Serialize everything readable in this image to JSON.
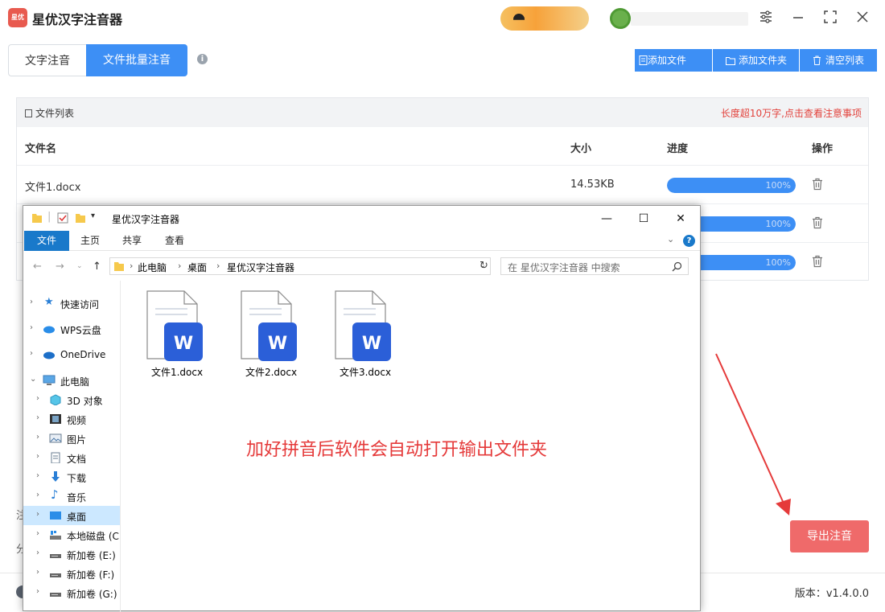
{
  "app": {
    "title": "星优汉字注音器",
    "logo_text": "星优",
    "version": "版本：v1.4.0.0"
  },
  "tabs": [
    {
      "label": "文字注音",
      "active": false
    },
    {
      "label": "文件批量注音",
      "active": true
    }
  ],
  "actions": {
    "add_file": "添加文件",
    "add_folder": "添加文件夹",
    "clear_list": "清空列表"
  },
  "file_list": {
    "title": "文件列表",
    "note": "长度超10万字,点击查看注意事项",
    "columns": [
      "文件名",
      "大小",
      "进度",
      "操作"
    ],
    "rows": [
      {
        "name": "文件1.docx",
        "size": "14.53KB",
        "progress": 100,
        "progress_label": "100%"
      },
      {
        "name": "",
        "size": "",
        "progress": 100,
        "progress_label": "100%"
      },
      {
        "name": "",
        "size": "",
        "progress": 100,
        "progress_label": "100%"
      }
    ]
  },
  "bottom": {
    "export_label": "导出注音",
    "stub_1": "注",
    "stub_2": "分"
  },
  "explorer": {
    "title": "星优汉字注音器",
    "ribbon": [
      "文件",
      "主页",
      "共享",
      "查看"
    ],
    "address": [
      "此电脑",
      "桌面",
      "星优汉字注音器"
    ],
    "search_placeholder": "在 星优汉字注音器 中搜索",
    "nav": [
      {
        "label": "快速访问",
        "icon": "star-icon"
      },
      {
        "label": "WPS云盘",
        "icon": "cloud-icon"
      },
      {
        "label": "OneDrive",
        "icon": "onedrive-icon"
      },
      {
        "label": "此电脑",
        "icon": "computer-icon"
      },
      {
        "label": "3D 对象",
        "icon": "cube-icon"
      },
      {
        "label": "视频",
        "icon": "video-icon"
      },
      {
        "label": "图片",
        "icon": "picture-icon"
      },
      {
        "label": "文档",
        "icon": "document-icon"
      },
      {
        "label": "下载",
        "icon": "download-icon"
      },
      {
        "label": "音乐",
        "icon": "music-icon"
      },
      {
        "label": "桌面",
        "icon": "desktop-icon"
      },
      {
        "label": "本地磁盘 (C:",
        "icon": "disk-icon"
      },
      {
        "label": "新加卷 (E:)",
        "icon": "drive-icon"
      },
      {
        "label": "新加卷 (F:)",
        "icon": "drive-icon"
      },
      {
        "label": "新加卷 (G:)",
        "icon": "drive-icon"
      }
    ],
    "files": [
      "文件1.docx",
      "文件2.docx",
      "文件3.docx"
    ]
  },
  "annotation": "加好拼音后软件会自动打开输出文件夹",
  "colors": {
    "accent": "#3d8ff5",
    "export": "#ef6a6a",
    "warning_text": "#e2413b",
    "annotation": "#e53a3a"
  }
}
